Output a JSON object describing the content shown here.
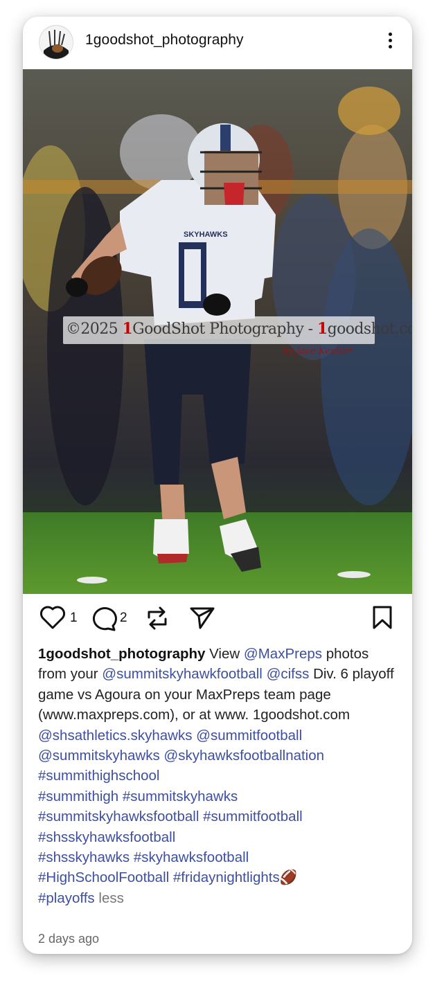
{
  "post": {
    "username": "1goodshot_photography",
    "watermark": {
      "copyright": "©2025 ",
      "brand_num": "1",
      "brand_rest": "GoodShot Photography - ",
      "site_num": "1",
      "site_rest": "goodshot.com",
      "signature": "by Jace Kessler"
    },
    "likes": "1",
    "comments": "2",
    "caption": {
      "author": "1goodshot_photography",
      "t1": " View ",
      "m1": "@MaxPreps",
      "t2": " photos from your ",
      "m2": "@summitskyhawkfootball",
      "t3": " ",
      "m3": "@cifss",
      "t4": " Div. 6 playoff game vs Agoura on your MaxPreps team page (www.maxpreps.com), or at www. 1goodshot.com",
      "l1": "@shsathletics.skyhawks @summitfootball",
      "l2": "@summitskyhawks @skyhawksfootballnation",
      "l3": "#summithighschool",
      "l4": "#summithigh #summitskyhawks",
      "l5": "#summitskyhawksfootball #summitfootball",
      "l6": "#shsskyhawksfootball",
      "l7": "#shsskyhawks #skyhawksfootball",
      "l8": "#HighSchoolFootball #fridaynightlights🏈",
      "l9": "#playoffs",
      "less": " less"
    },
    "time": "2 days ago"
  },
  "icons": {
    "more": "more-vertical-icon",
    "like": "heart-icon",
    "comment": "comment-icon",
    "repost": "repost-icon",
    "share": "send-icon",
    "save": "bookmark-icon"
  },
  "colors": {
    "link": "#3d4fa0",
    "text": "#222222",
    "muted": "#777777"
  }
}
